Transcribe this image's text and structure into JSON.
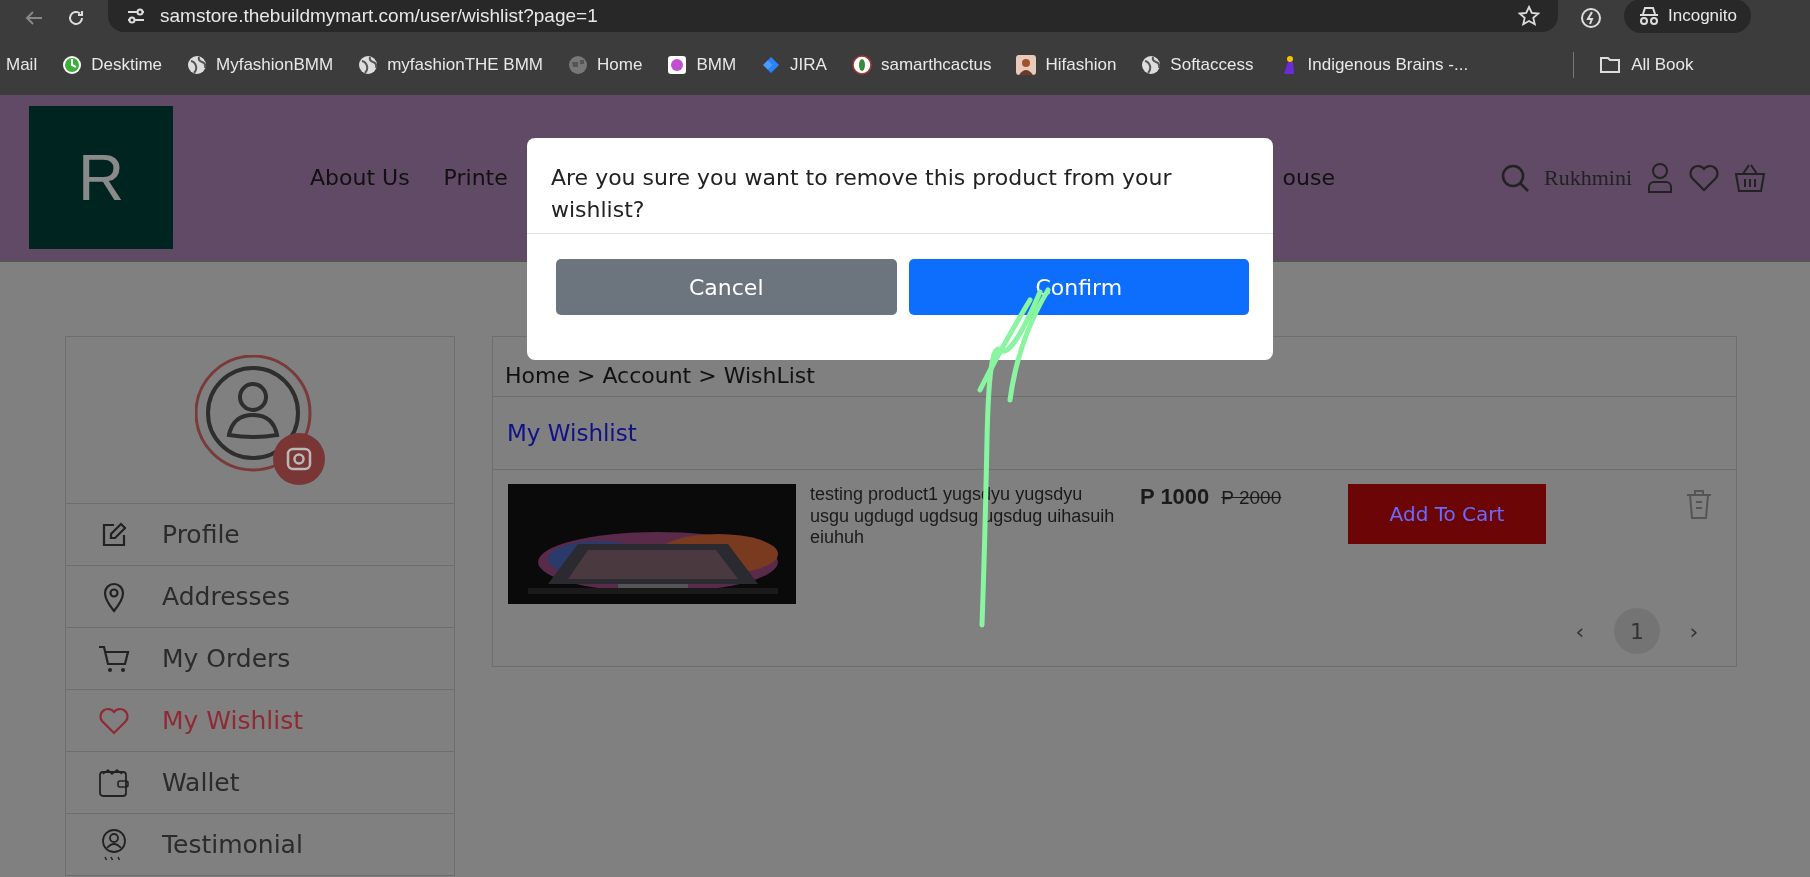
{
  "browser": {
    "url": "samstore.thebuildmymart.com/user/wishlist?page=1",
    "profile_label": "Incognito",
    "bookmarks": [
      {
        "label": "Mail"
      },
      {
        "label": "Desktime"
      },
      {
        "label": "MyfashionBMM"
      },
      {
        "label": "myfashionTHE BMM"
      },
      {
        "label": "Home"
      },
      {
        "label": "BMM"
      },
      {
        "label": "JIRA"
      },
      {
        "label": "samarthcactus"
      },
      {
        "label": "Hifashion"
      },
      {
        "label": "Softaccess"
      },
      {
        "label": "Indigenous Brains -..."
      }
    ],
    "all_bookmarks": "All Book"
  },
  "header": {
    "logo_letter": "R",
    "nav": [
      "About Us",
      "Printe",
      "ouse"
    ],
    "user_name": "Rukhmini"
  },
  "sidebar": {
    "items": [
      {
        "label": "Profile",
        "selected": false
      },
      {
        "label": "Addresses",
        "selected": false
      },
      {
        "label": "My Orders",
        "selected": false
      },
      {
        "label": "My Wishlist",
        "selected": true
      },
      {
        "label": "Wallet",
        "selected": false
      },
      {
        "label": "Testimonial",
        "selected": false
      }
    ]
  },
  "breadcrumb": "Home > Account > WishList",
  "wishlist": {
    "title": "My Wishlist",
    "items": [
      {
        "title": "testing product1 yugsdyu yugsdyu usgu ugdugd ugdsug ugsdug uihasuih eiuhuh",
        "price": "P 1000",
        "original_price": "P 2000",
        "add_button": "Add To Cart"
      }
    ],
    "pagination": {
      "previous": "‹",
      "pages": [
        {
          "label": "1",
          "selected": true
        }
      ],
      "next": "›"
    }
  },
  "dialog": {
    "message": "Are you sure you want to remove this product from your wishlist?",
    "buttons": [
      {
        "label": "Cancel",
        "kind": "cancel"
      },
      {
        "label": "Confirm",
        "kind": "confirm"
      }
    ]
  }
}
